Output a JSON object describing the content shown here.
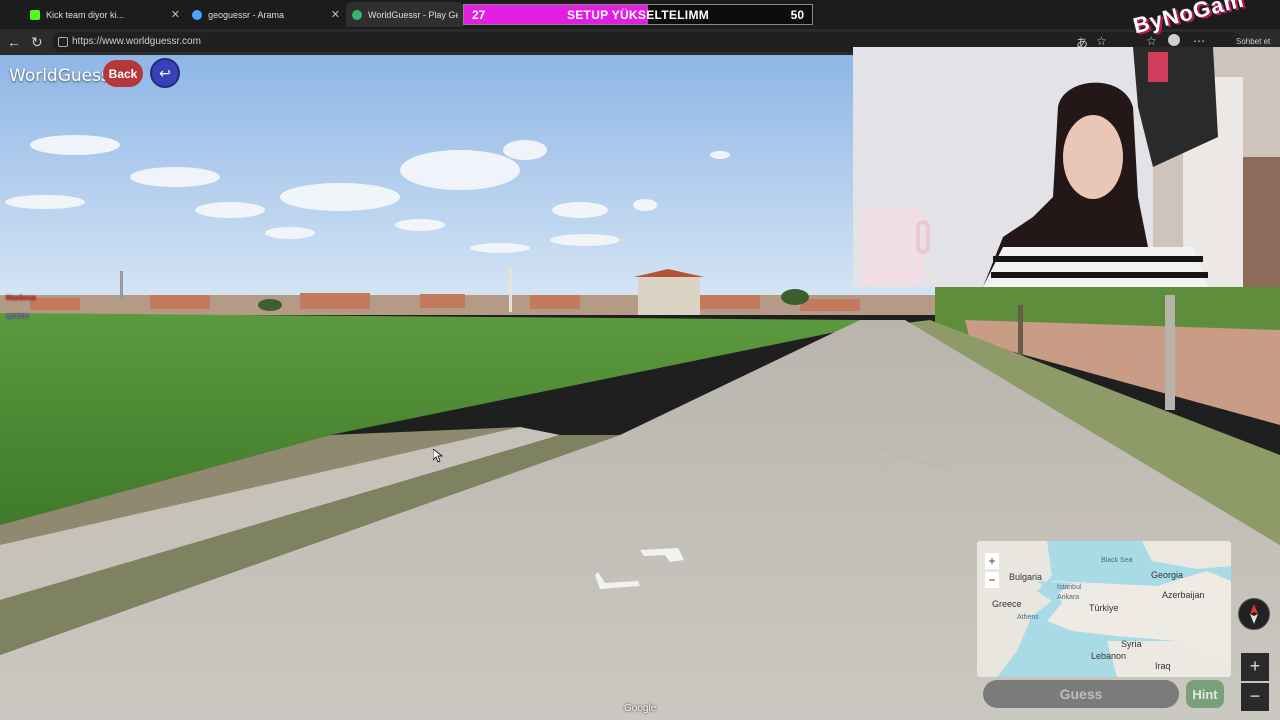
{
  "browser": {
    "tabs": [
      {
        "title": "Kick team diyor ki...",
        "active": false,
        "favicon_color": "#53fc18"
      },
      {
        "title": "geoguessr - Arama",
        "active": false,
        "favicon_color": "#4fa3ff"
      },
      {
        "title": "WorldGuessr - Play Geogue",
        "active": true,
        "favicon_color": "#3bb273"
      }
    ],
    "url": "https://www.worldguessr.com",
    "sidebar_label": "Sohbet et"
  },
  "overlay": {
    "goal_start": "27",
    "goal_title": "SETUP YÜKSELTELIMM",
    "goal_end": "50",
    "goal_progress_fraction": 0.53,
    "brand": "ByNoGam",
    "accent": "#e21ee2"
  },
  "game": {
    "logo": "WorldGuessr",
    "back_label": "Back",
    "undo_icon": "undo-icon",
    "guess_label": "Guess",
    "hint_label": "Hint",
    "attribution": "Google",
    "chat_user1": "Maxbeco",
    "chat_user2": "aynene",
    "map": {
      "labels": {
        "black_sea": "Black Sea",
        "bulgaria": "Bulgaria",
        "georgia": "Georgia",
        "istanbul": "İstanbul",
        "ankara": "Ankara",
        "azerbaijan": "Azerbaijan",
        "greece": "Greece",
        "turkiye": "Türkiye",
        "athens": "Athens",
        "syria": "Syria",
        "lebanon": "Lebanon",
        "iraq": "Iraq"
      },
      "zoom_in": "+",
      "zoom_out": "−"
    },
    "side_plus": "+",
    "side_minus": "−"
  }
}
